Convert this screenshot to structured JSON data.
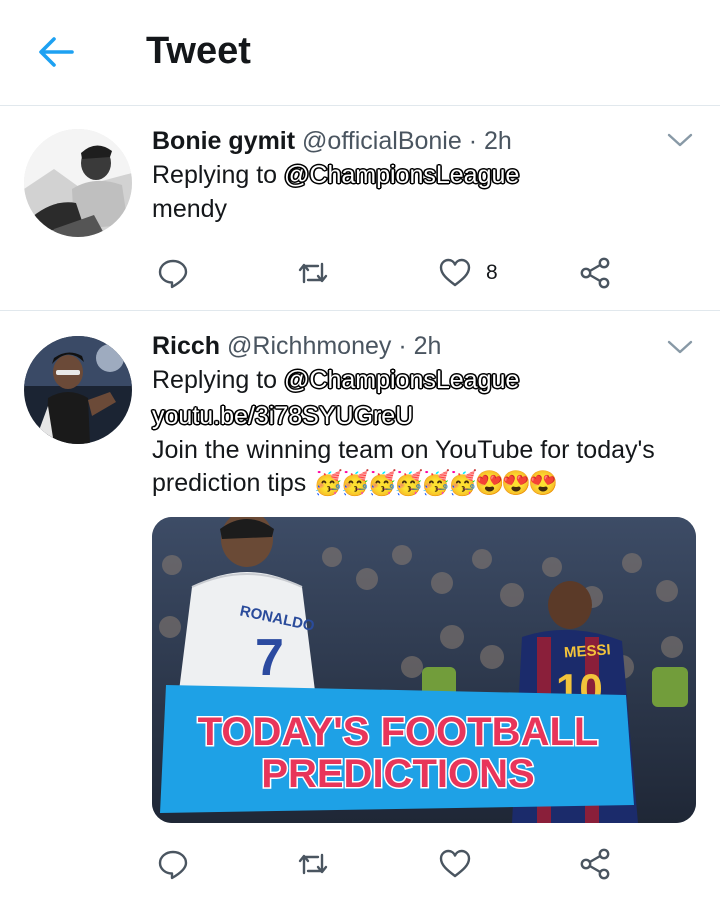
{
  "header": {
    "title": "Tweet",
    "back_icon": "arrow-left-icon",
    "accent_color": "#1da1f2"
  },
  "tweets": [
    {
      "name": "Bonie gymit",
      "handle": "@officialBonie",
      "separator": "·",
      "time": "2h",
      "replying_prefix": "Replying to",
      "replying_to": "@ChampionsLeague",
      "text": "mendy",
      "likes": "8"
    },
    {
      "name": "Ricch",
      "handle": "@Richhmoney",
      "separator": "·",
      "time": "2h",
      "replying_prefix": "Replying to",
      "replying_to": "@ChampionsLeague",
      "link": "youtu.be/3i78SYUGreU",
      "text": "Join the winning team on YouTube for today's prediction tips",
      "emojis": "🥳🥳🥳🥳🥳🥳😍😍😍",
      "media": {
        "jersey_left_name": "RONALDO",
        "jersey_left_number": "7",
        "jersey_right_name": "MESSI",
        "jersey_right_number": "10",
        "banner_line1": "TODAY'S FOOTBALL",
        "banner_line2": "PREDICTIONS"
      }
    }
  ],
  "icons": {
    "reply": "reply-icon",
    "retweet": "retweet-icon",
    "like": "heart-icon",
    "share": "share-icon",
    "more": "chevron-down-icon"
  }
}
